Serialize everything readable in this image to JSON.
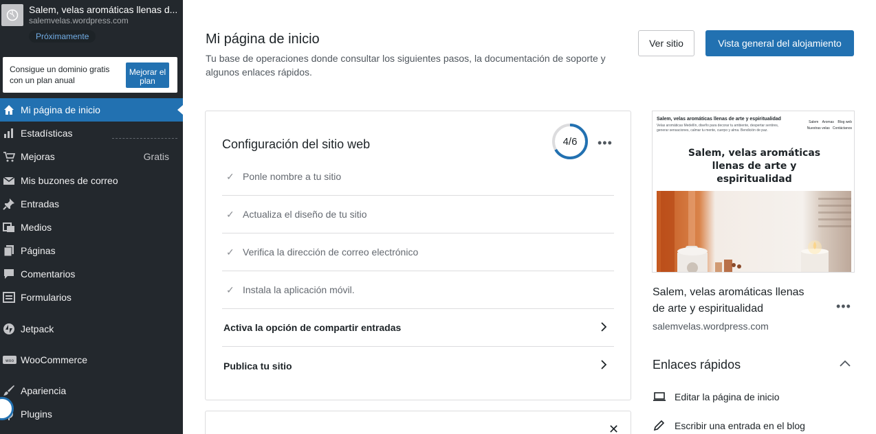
{
  "site": {
    "name": "Salem, velas aromáticas llenas d...",
    "url": "salemvelas.wordpress.com",
    "badge": "Próximamente"
  },
  "promo": {
    "text": "Consigue un dominio gratis con un plan anual",
    "button": "Mejorar el plan"
  },
  "nav": [
    {
      "label": "Mi página de inicio",
      "icon": "home-icon",
      "active": true
    },
    {
      "label": "Estadísticas",
      "icon": "stats-icon"
    },
    {
      "label": "Mejoras",
      "icon": "cart-icon",
      "extra": "Gratis"
    },
    {
      "label": "Mis buzones de correo",
      "icon": "mail-icon"
    },
    {
      "label": "Entradas",
      "icon": "pin-icon"
    },
    {
      "label": "Medios",
      "icon": "media-icon"
    },
    {
      "label": "Páginas",
      "icon": "pages-icon"
    },
    {
      "label": "Comentarios",
      "icon": "comment-icon"
    },
    {
      "label": "Formularios",
      "icon": "forms-icon"
    },
    {
      "label": "Jetpack",
      "icon": "jetpack-icon"
    },
    {
      "label": "WooCommerce",
      "icon": "woo-icon"
    },
    {
      "label": "Apariencia",
      "icon": "brush-icon"
    },
    {
      "label": "Plugins",
      "icon": "plugin-icon"
    }
  ],
  "header": {
    "title": "Mi página de inicio",
    "description": "Tu base de operaciones donde consultar los siguientes pasos, la documentación de soporte y algunos enlaces rápidos.",
    "view_site": "Ver sitio",
    "hosting": "Vista general del alojamiento"
  },
  "setup": {
    "title": "Configuración del sitio web",
    "progress_text": "4/6",
    "progress_fraction": 0.6667,
    "tasks": [
      {
        "label": "Ponle nombre a tu sitio",
        "done": true
      },
      {
        "label": "Actualiza el diseño de tu sitio",
        "done": true
      },
      {
        "label": "Verifica la dirección de correo electrónico",
        "done": true
      },
      {
        "label": "Instala la aplicación móvil.",
        "done": true
      },
      {
        "label": "Activa la opción de compartir entradas",
        "done": false
      },
      {
        "label": "Publica tu sitio",
        "done": false
      }
    ]
  },
  "preview": {
    "site_name": "Salem, velas aromáticas llenas de arte y espiritualidad",
    "tagline": "Velas aromáticas Medellín, diseño para decorar tu ambiente, despertar sentires, generar sensaciones, calmar tu mente, cuerpo y alma. Bendición de paz.",
    "nav": [
      "Salem",
      "Aromas",
      "Blog web",
      "Nuestras velas",
      "Contáctanos"
    ],
    "headline": "Salem, velas aromáticas llenas de arte y espiritualidad"
  },
  "site_card": {
    "title": "Salem, velas aromáticas llenas de arte y espiritualidad",
    "url": "salemvelas.wordpress.com"
  },
  "quick_links": {
    "title": "Enlaces rápidos",
    "items": [
      {
        "label": "Editar la página de inicio",
        "icon": "laptop-icon"
      },
      {
        "label": "Escribir una entrada en el blog",
        "icon": "pencil-icon"
      }
    ]
  },
  "colors": {
    "accent": "#2271b1",
    "sidebar": "#23282d"
  }
}
